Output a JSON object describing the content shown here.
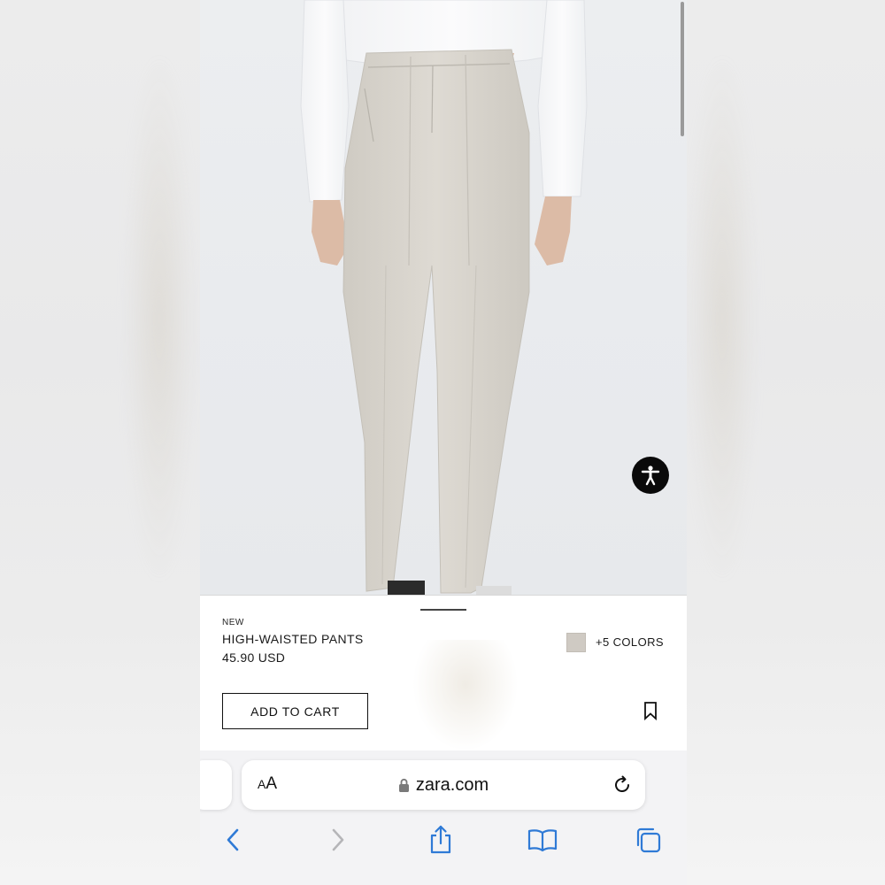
{
  "product": {
    "tag": "NEW",
    "name": "HIGH-WAISTED PANTS",
    "price": "45.90 USD",
    "colors_label": "+5 COLORS",
    "swatch_color": "#cfcac3",
    "add_to_cart_label": "ADD TO CART"
  },
  "browser": {
    "text_size_label_small": "A",
    "text_size_label_large": "A",
    "url": "zara.com",
    "accent_color": "#2f7ad6"
  },
  "icons": {
    "accessibility": "accessibility-icon",
    "bookmark": "bookmark-icon",
    "lock": "lock-icon",
    "reload": "reload-icon",
    "back": "chevron-left-icon",
    "forward": "chevron-right-icon",
    "share": "share-icon",
    "bookmarks": "book-icon",
    "tabs": "tabs-icon"
  }
}
